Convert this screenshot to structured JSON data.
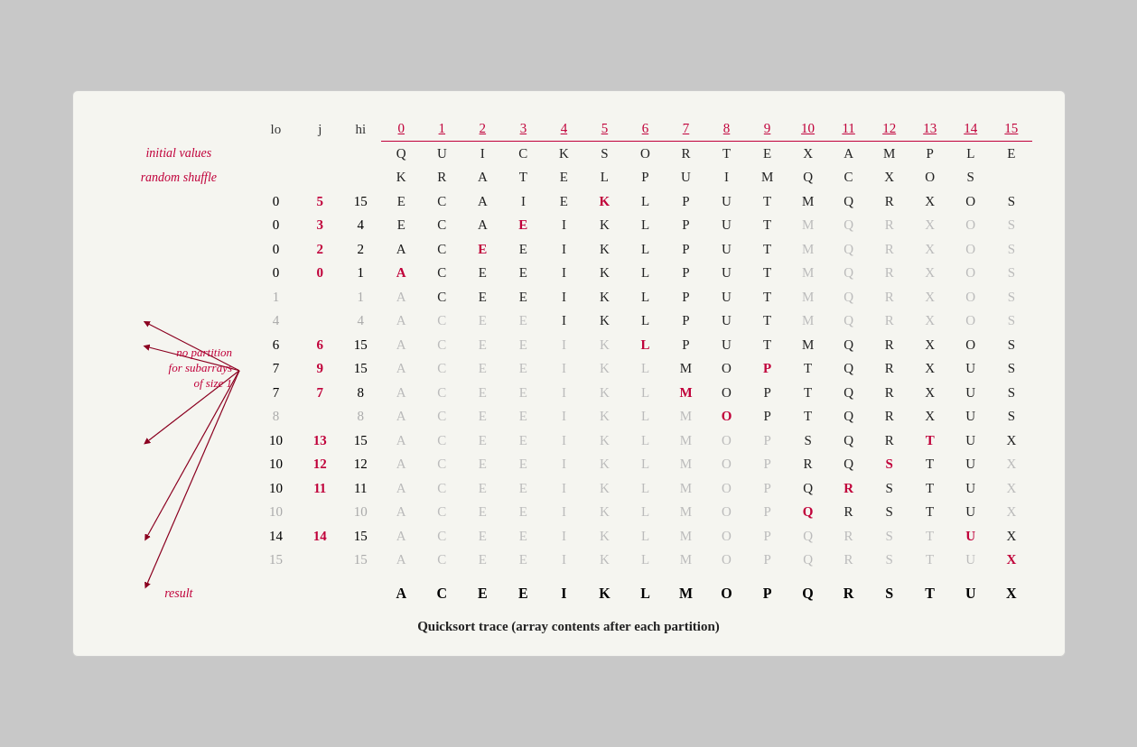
{
  "title": "Quicksort trace (array contents after each partition)",
  "header": {
    "lo": "lo",
    "j": "j",
    "hi": "hi",
    "indices": [
      "0",
      "1",
      "2",
      "3",
      "4",
      "5",
      "6",
      "7",
      "8",
      "9",
      "10",
      "11",
      "12",
      "13",
      "14",
      "15"
    ]
  },
  "labels": {
    "initial_values": "initial values",
    "random_shuffle": "random shuffle",
    "result": "result",
    "no_partition": "no partition\nfor subarrays\nof size 1"
  },
  "rows": [
    {
      "lo": "",
      "j": "",
      "hi": "",
      "arr": [
        "Q",
        "U",
        "I",
        "C",
        "K",
        "S",
        "O",
        "R",
        "T",
        "E",
        "X",
        "A",
        "M",
        "P",
        "L",
        "E"
      ],
      "styles": [
        "",
        "",
        "",
        "",
        "",
        "",
        "",
        "",
        "",
        "",
        "",
        "",
        "",
        "",
        "",
        ""
      ]
    },
    {
      "lo": "",
      "j": "",
      "hi": "",
      "arr": [
        "K",
        "R",
        "A",
        "T",
        "E",
        "L",
        "P",
        "U",
        "I",
        "M",
        "Q",
        "C",
        "X",
        "O",
        "S",
        ""
      ],
      "styles": [
        "",
        "",
        "",
        "",
        "",
        "",
        "",
        "",
        "",
        "",
        "",
        "",
        "",
        "",
        "",
        ""
      ]
    },
    {
      "lo": "0",
      "j": "5",
      "hi": "15",
      "arr": [
        "E",
        "C",
        "A",
        "I",
        "E",
        "K",
        "L",
        "P",
        "U",
        "T",
        "M",
        "Q",
        "R",
        "X",
        "O",
        "S"
      ],
      "styles": [
        "",
        "",
        "",
        "",
        "",
        "red",
        "",
        "",
        "",
        "",
        "",
        "",
        "",
        "",
        "",
        ""
      ]
    },
    {
      "lo": "0",
      "j": "3",
      "hi": "4",
      "arr": [
        "E",
        "C",
        "A",
        "E",
        "I",
        "K",
        "L",
        "P",
        "U",
        "T",
        "M",
        "Q",
        "R",
        "X",
        "O",
        "S"
      ],
      "styles": [
        "",
        "",
        "",
        "red",
        "",
        "",
        "",
        "",
        "",
        "",
        "gray",
        "gray",
        "gray",
        "gray",
        "gray",
        "gray"
      ]
    },
    {
      "lo": "0",
      "j": "2",
      "hi": "2",
      "arr": [
        "A",
        "C",
        "E",
        "E",
        "I",
        "K",
        "L",
        "P",
        "U",
        "T",
        "M",
        "Q",
        "R",
        "X",
        "O",
        "S"
      ],
      "styles": [
        "",
        "",
        "red",
        "",
        "",
        "",
        "",
        "",
        "",
        "",
        "gray",
        "gray",
        "gray",
        "gray",
        "gray",
        "gray"
      ]
    },
    {
      "lo": "0",
      "j": "0",
      "hi": "1",
      "arr": [
        "A",
        "C",
        "E",
        "E",
        "I",
        "K",
        "L",
        "P",
        "U",
        "T",
        "M",
        "Q",
        "R",
        "X",
        "O",
        "S"
      ],
      "styles": [
        "red",
        "",
        "",
        "",
        "",
        "",
        "",
        "",
        "",
        "",
        "gray",
        "gray",
        "gray",
        "gray",
        "gray",
        "gray"
      ]
    },
    {
      "lo": "1",
      "j": "",
      "hi": "1",
      "arr": [
        "A",
        "C",
        "E",
        "E",
        "I",
        "K",
        "L",
        "P",
        "U",
        "T",
        "M",
        "Q",
        "R",
        "X",
        "O",
        "S"
      ],
      "styles": [
        "gray",
        "",
        "",
        "",
        "",
        "",
        "",
        "",
        "",
        "",
        "gray",
        "gray",
        "gray",
        "gray",
        "gray",
        "gray"
      ],
      "lo_gray": true
    },
    {
      "lo": "4",
      "j": "",
      "hi": "4",
      "arr": [
        "A",
        "C",
        "E",
        "E",
        "I",
        "K",
        "L",
        "P",
        "U",
        "T",
        "M",
        "Q",
        "R",
        "X",
        "O",
        "S"
      ],
      "styles": [
        "gray",
        "gray",
        "gray",
        "gray",
        "",
        "",
        "",
        "",
        "",
        "",
        "gray",
        "gray",
        "gray",
        "gray",
        "gray",
        "gray"
      ],
      "lo_gray": true
    },
    {
      "lo": "6",
      "j": "6",
      "hi": "15",
      "arr": [
        "A",
        "C",
        "E",
        "E",
        "I",
        "K",
        "L",
        "P",
        "U",
        "T",
        "M",
        "Q",
        "R",
        "X",
        "O",
        "S"
      ],
      "styles": [
        "gray",
        "gray",
        "gray",
        "gray",
        "gray",
        "gray",
        "red",
        "",
        "",
        "",
        "",
        "",
        "",
        "",
        "",
        ""
      ]
    },
    {
      "lo": "7",
      "j": "9",
      "hi": "15",
      "arr": [
        "A",
        "C",
        "E",
        "E",
        "I",
        "K",
        "L",
        "M",
        "O",
        "P",
        "T",
        "Q",
        "R",
        "X",
        "U",
        "S"
      ],
      "styles": [
        "gray",
        "gray",
        "gray",
        "gray",
        "gray",
        "gray",
        "gray",
        "",
        "",
        "red",
        "",
        "",
        "",
        "",
        "",
        ""
      ]
    },
    {
      "lo": "7",
      "j": "7",
      "hi": "8",
      "arr": [
        "A",
        "C",
        "E",
        "E",
        "I",
        "K",
        "L",
        "M",
        "O",
        "P",
        "T",
        "Q",
        "R",
        "X",
        "U",
        "S"
      ],
      "styles": [
        "gray",
        "gray",
        "gray",
        "gray",
        "gray",
        "gray",
        "gray",
        "red",
        "",
        "",
        "",
        "",
        "",
        "",
        "",
        ""
      ]
    },
    {
      "lo": "8",
      "j": "",
      "hi": "8",
      "arr": [
        "A",
        "C",
        "E",
        "E",
        "I",
        "K",
        "L",
        "M",
        "O",
        "P",
        "T",
        "Q",
        "R",
        "X",
        "U",
        "S"
      ],
      "styles": [
        "gray",
        "gray",
        "gray",
        "gray",
        "gray",
        "gray",
        "gray",
        "gray",
        "red",
        "",
        "",
        "",
        "",
        "",
        "",
        ""
      ],
      "lo_gray": true
    },
    {
      "lo": "10",
      "j": "13",
      "hi": "15",
      "arr": [
        "A",
        "C",
        "E",
        "E",
        "I",
        "K",
        "L",
        "M",
        "O",
        "P",
        "S",
        "Q",
        "R",
        "T",
        "U",
        "X"
      ],
      "styles": [
        "gray",
        "gray",
        "gray",
        "gray",
        "gray",
        "gray",
        "gray",
        "gray",
        "gray",
        "gray",
        "",
        "",
        "",
        "red",
        "",
        ""
      ]
    },
    {
      "lo": "10",
      "j": "12",
      "hi": "12",
      "arr": [
        "A",
        "C",
        "E",
        "E",
        "I",
        "K",
        "L",
        "M",
        "O",
        "P",
        "R",
        "Q",
        "S",
        "T",
        "U",
        "X"
      ],
      "styles": [
        "gray",
        "gray",
        "gray",
        "gray",
        "gray",
        "gray",
        "gray",
        "gray",
        "gray",
        "gray",
        "",
        "",
        "red",
        "",
        "",
        "gray"
      ]
    },
    {
      "lo": "10",
      "j": "11",
      "hi": "11",
      "arr": [
        "A",
        "C",
        "E",
        "E",
        "I",
        "K",
        "L",
        "M",
        "O",
        "P",
        "Q",
        "R",
        "S",
        "T",
        "U",
        "X"
      ],
      "styles": [
        "gray",
        "gray",
        "gray",
        "gray",
        "gray",
        "gray",
        "gray",
        "gray",
        "gray",
        "gray",
        "",
        "red",
        "",
        "",
        "",
        "gray"
      ]
    },
    {
      "lo": "10",
      "j": "",
      "hi": "10",
      "arr": [
        "A",
        "C",
        "E",
        "E",
        "I",
        "K",
        "L",
        "M",
        "O",
        "P",
        "Q",
        "R",
        "S",
        "T",
        "U",
        "X"
      ],
      "styles": [
        "gray",
        "gray",
        "gray",
        "gray",
        "gray",
        "gray",
        "gray",
        "gray",
        "gray",
        "gray",
        "red",
        "",
        "",
        "",
        "",
        "gray"
      ],
      "lo_gray": true
    },
    {
      "lo": "14",
      "j": "14",
      "hi": "15",
      "arr": [
        "A",
        "C",
        "E",
        "E",
        "I",
        "K",
        "L",
        "M",
        "O",
        "P",
        "Q",
        "R",
        "S",
        "T",
        "U",
        "X"
      ],
      "styles": [
        "gray",
        "gray",
        "gray",
        "gray",
        "gray",
        "gray",
        "gray",
        "gray",
        "gray",
        "gray",
        "gray",
        "gray",
        "gray",
        "gray",
        "red",
        ""
      ]
    },
    {
      "lo": "15",
      "j": "",
      "hi": "15",
      "arr": [
        "A",
        "C",
        "E",
        "E",
        "I",
        "K",
        "L",
        "M",
        "O",
        "P",
        "Q",
        "R",
        "S",
        "T",
        "U",
        "X"
      ],
      "styles": [
        "gray",
        "gray",
        "gray",
        "gray",
        "gray",
        "gray",
        "gray",
        "gray",
        "gray",
        "gray",
        "gray",
        "gray",
        "gray",
        "gray",
        "gray",
        "red"
      ],
      "lo_gray": true
    }
  ],
  "result_row": {
    "arr": [
      "A",
      "C",
      "E",
      "E",
      "I",
      "K",
      "L",
      "M",
      "O",
      "P",
      "Q",
      "R",
      "S",
      "T",
      "U",
      "X"
    ]
  }
}
